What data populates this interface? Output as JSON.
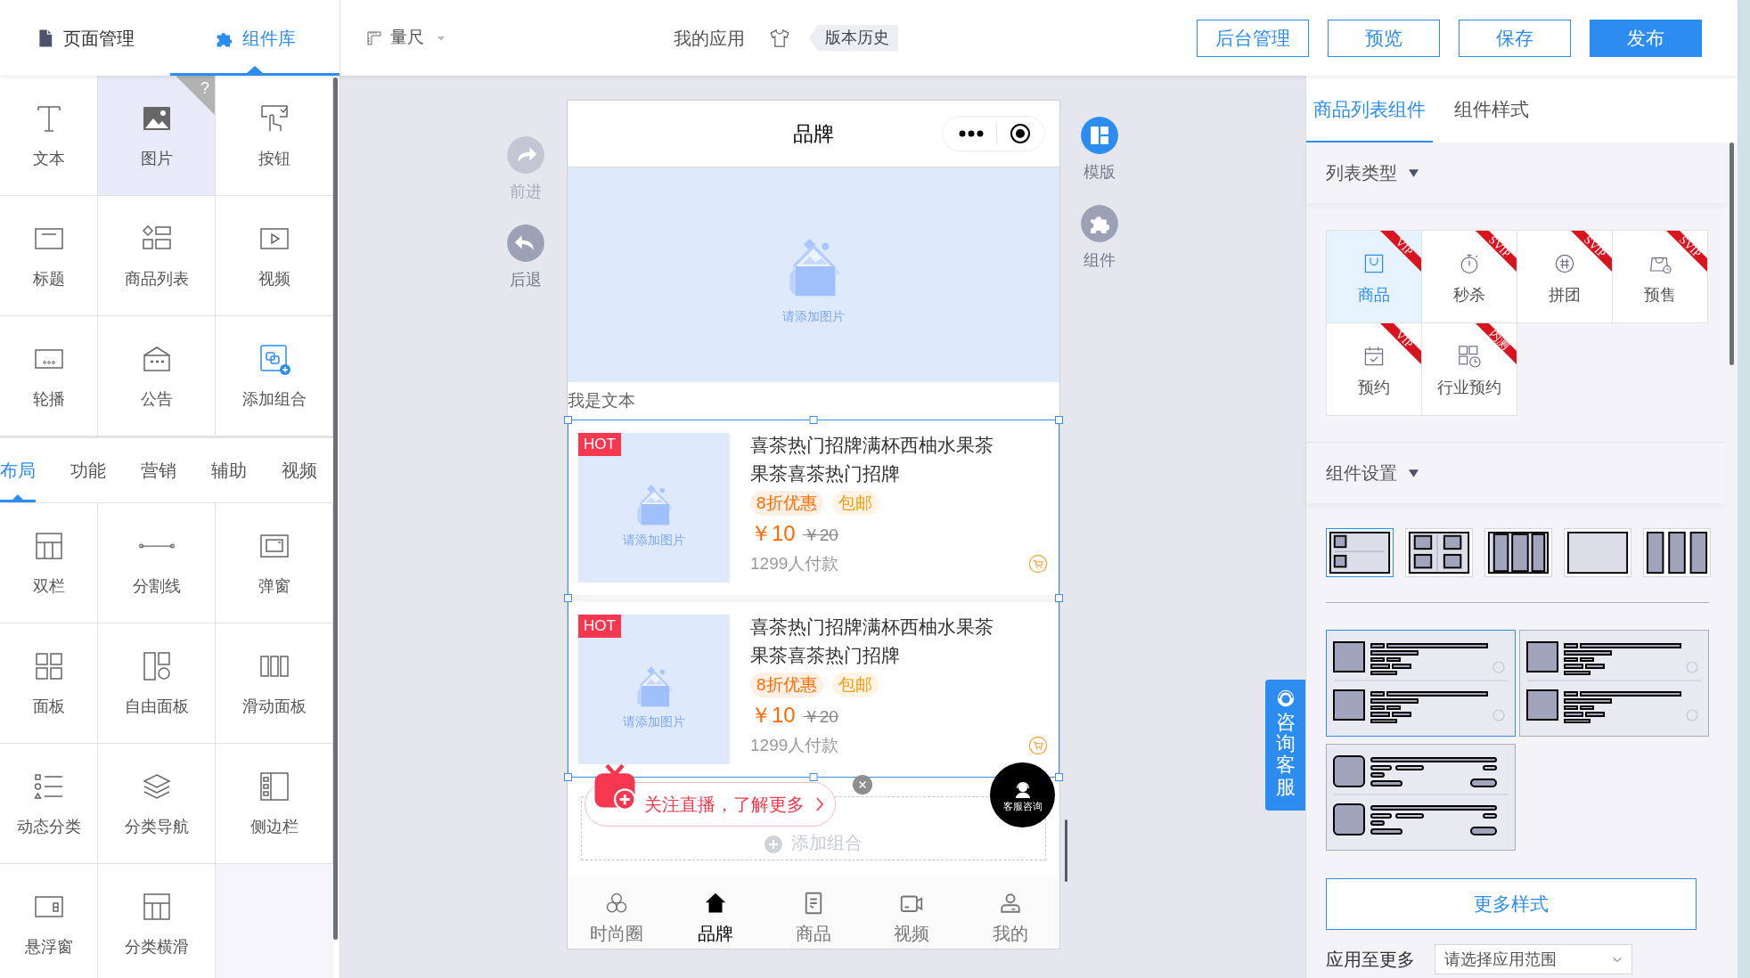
{
  "top_tabs": [
    {
      "label": "页面管理",
      "kind": "document",
      "selected": false
    },
    {
      "label": "组件库",
      "kind": "puzzle",
      "selected": true
    }
  ],
  "toolbar": {
    "ruler": "量尺",
    "my_apps": "我的应用",
    "version_history": "版本历史"
  },
  "actions": [
    {
      "label": "后台管理",
      "primary": false
    },
    {
      "label": "预览",
      "primary": false
    },
    {
      "label": "保存",
      "primary": false
    },
    {
      "label": "发布",
      "primary": true
    }
  ],
  "basic_components": [
    {
      "label": "文本",
      "kind": "text",
      "selected": false
    },
    {
      "label": "图片",
      "kind": "image",
      "selected": true,
      "help": "?"
    },
    {
      "label": "按钮",
      "kind": "button",
      "selected": false
    },
    {
      "label": "标题",
      "kind": "heading",
      "selected": false
    },
    {
      "label": "商品列表",
      "kind": "product_list",
      "selected": false
    },
    {
      "label": "视频",
      "kind": "video",
      "selected": false
    },
    {
      "label": "轮播",
      "kind": "carousel",
      "selected": false
    },
    {
      "label": "公告",
      "kind": "notice",
      "selected": false
    },
    {
      "label": "添加组合",
      "kind": "add_group",
      "selected": false
    }
  ],
  "category_tabs": [
    {
      "label": "布局",
      "selected": true
    },
    {
      "label": "功能",
      "selected": false
    },
    {
      "label": "营销",
      "selected": false
    },
    {
      "label": "辅助",
      "selected": false
    },
    {
      "label": "视频",
      "selected": false
    }
  ],
  "layout_components": [
    {
      "label": "双栏",
      "kind": "two_column"
    },
    {
      "label": "分割线",
      "kind": "divider"
    },
    {
      "label": "弹窗",
      "kind": "popup"
    },
    {
      "label": "面板",
      "kind": "panel"
    },
    {
      "label": "自由面板",
      "kind": "free_panel"
    },
    {
      "label": "滑动面板",
      "kind": "slide_panel"
    },
    {
      "label": "动态分类",
      "kind": "dynamic_category"
    },
    {
      "label": "分类导航",
      "kind": "category_nav"
    },
    {
      "label": "侧边栏",
      "kind": "sidebar"
    },
    {
      "label": "悬浮窗",
      "kind": "float_window"
    },
    {
      "label": "分类横滑",
      "kind": "category_slide"
    }
  ],
  "canvas_nav_left": [
    {
      "label": "前进",
      "kind": "forward",
      "disabled": true
    },
    {
      "label": "后退",
      "kind": "back",
      "disabled": false
    }
  ],
  "canvas_nav_right": [
    {
      "label": "模版",
      "kind": "template",
      "active": true
    },
    {
      "label": "组件",
      "kind": "puzzle",
      "active": false
    }
  ],
  "phone": {
    "title": "品牌",
    "banner": {
      "placeholder": "请添加图片"
    },
    "text": "我是文本",
    "products": [
      {
        "badge": "HOT",
        "image_placeholder": "请添加图片",
        "title": "喜茶热门招牌满杯西柚水果茶果茶喜茶热门招牌",
        "tags": [
          {
            "label": "8折优惠",
            "color": "#ff6a00"
          },
          {
            "label": "包邮",
            "color": "#f59a0c"
          }
        ],
        "price": "￥10",
        "original_price": "￥20",
        "sales": "1299人付款"
      },
      {
        "badge": "HOT",
        "image_placeholder": "请添加图片",
        "title": "喜茶热门招牌满杯西柚水果茶果茶喜茶热门招牌",
        "tags": [
          {
            "label": "8折优惠",
            "color": "#ff6a00"
          },
          {
            "label": "包邮",
            "color": "#f59a0c"
          }
        ],
        "price": "￥10",
        "original_price": "￥20",
        "sales": "1299人付款"
      }
    ],
    "add_group": "添加组合",
    "live_banner": "关注直播，了解更多",
    "service": "客服咨询",
    "tabs": [
      {
        "label": "时尚圈",
        "kind": "circles",
        "selected": false
      },
      {
        "label": "品牌",
        "kind": "home",
        "selected": true
      },
      {
        "label": "商品",
        "kind": "document",
        "selected": false
      },
      {
        "label": "视频",
        "kind": "camera",
        "selected": false
      },
      {
        "label": "我的",
        "kind": "person",
        "selected": false
      }
    ]
  },
  "consult_tab": "咨询客服",
  "settings": {
    "tabs": [
      {
        "label": "商品列表组件",
        "selected": true
      },
      {
        "label": "组件样式",
        "selected": false
      }
    ],
    "list_type": {
      "title": "列表类型",
      "types": [
        {
          "label": "商品",
          "kind": "bag",
          "ribbon": "VIP",
          "selected": true
        },
        {
          "label": "秒杀",
          "kind": "stopwatch",
          "ribbon": "SVIP",
          "selected": false
        },
        {
          "label": "拼团",
          "kind": "group",
          "ribbon": "SVIP",
          "selected": false
        },
        {
          "label": "预售",
          "kind": "presale",
          "ribbon": "SVIP",
          "selected": false
        },
        {
          "label": "预约",
          "kind": "calendar",
          "ribbon": "VIP",
          "selected": false
        },
        {
          "label": "行业预约",
          "kind": "industry",
          "ribbon": "内测",
          "selected": false
        }
      ]
    },
    "component_settings": {
      "title": "组件设置",
      "layouts": [
        {
          "kind": "image_rows",
          "selected": true
        },
        {
          "kind": "grid",
          "selected": false
        },
        {
          "kind": "divided_columns",
          "selected": false
        },
        {
          "kind": "blank",
          "selected": false
        },
        {
          "kind": "columns",
          "selected": false
        }
      ],
      "styles": [
        {
          "kind": "list_radio",
          "selected": true
        },
        {
          "kind": "list_radio",
          "selected": false
        },
        {
          "kind": "list_button",
          "selected": false
        }
      ]
    },
    "more_styles": "更多样式",
    "apply": {
      "label": "应用至更多",
      "placeholder": "请选择应用范围"
    }
  }
}
